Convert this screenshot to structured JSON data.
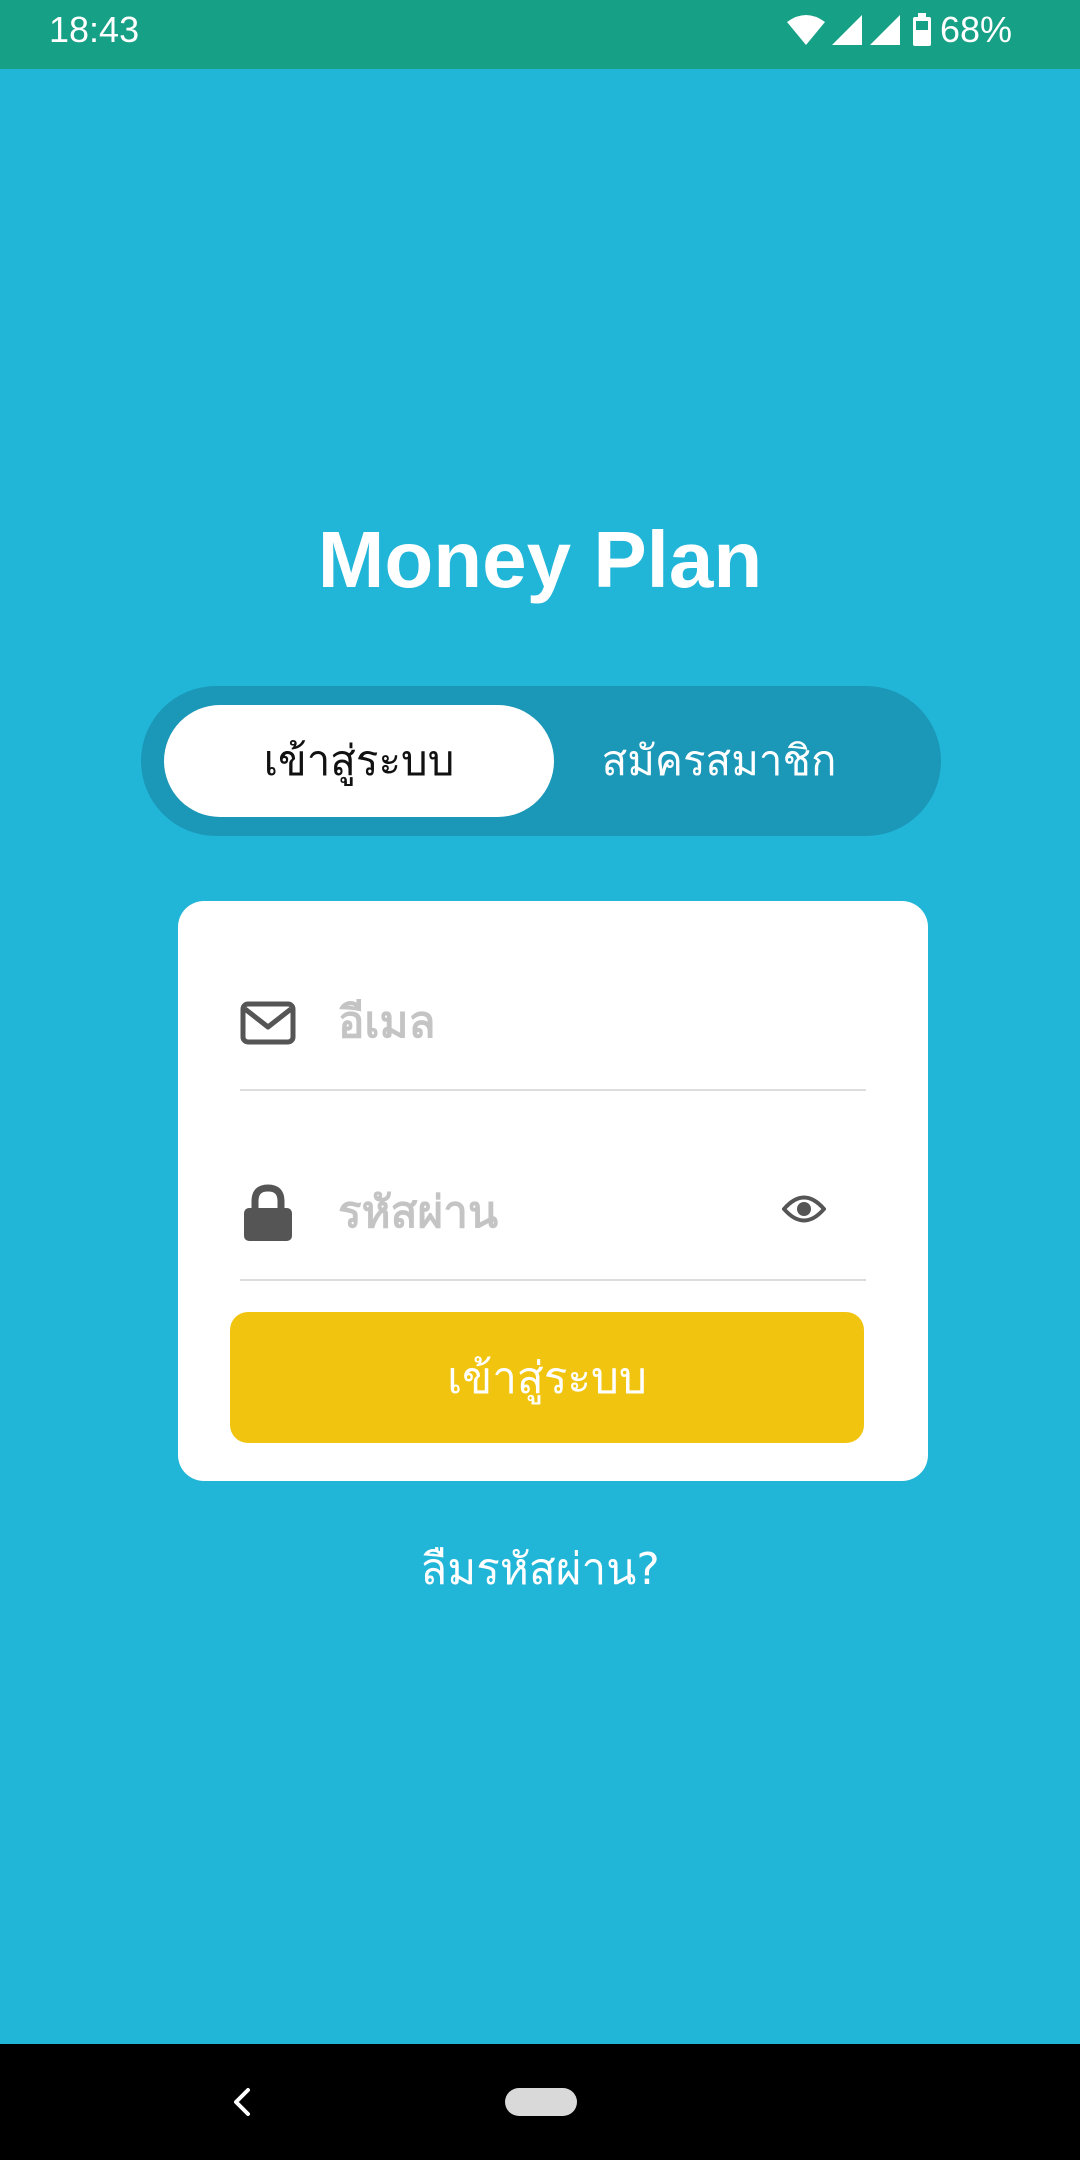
{
  "status_bar": {
    "time": "18:43",
    "battery_percent": "68%",
    "icons": [
      "wifi-icon",
      "signal-icon",
      "signal-icon",
      "battery-icon"
    ]
  },
  "app": {
    "title": "Money Plan"
  },
  "tabs": [
    {
      "label": "เข้าสู่ระบบ",
      "selected": true
    },
    {
      "label": "สมัครสมาชิก",
      "selected": false
    }
  ],
  "login_form": {
    "email": {
      "placeholder": "อีเมล",
      "value": "",
      "icon": "envelope-icon"
    },
    "password": {
      "placeholder": "รหัสผ่าน",
      "value": "",
      "icon": "lock-icon",
      "toggle_icon": "eye-icon"
    },
    "submit_label": "เข้าสู่ระบบ"
  },
  "forgot_password_label": "ลืมรหัสผ่าน?",
  "colors": {
    "background": "#21b5d8",
    "status_bar": "#16a085",
    "tab_track": "#1b97b7",
    "submit_button": "#f0c40f"
  }
}
